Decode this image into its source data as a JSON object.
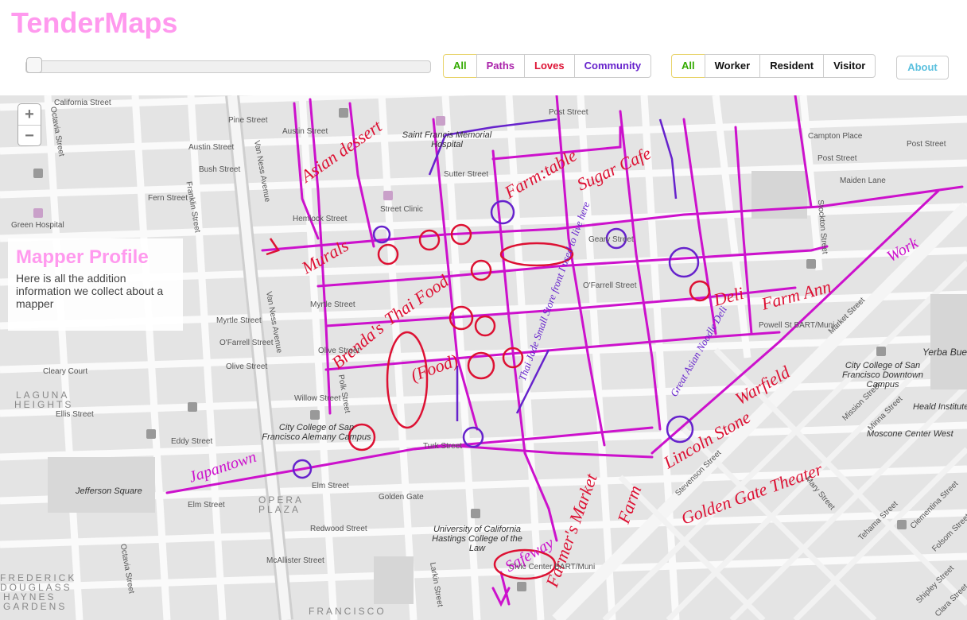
{
  "app": {
    "title": "TenderMaps"
  },
  "filters": {
    "type_buttons": [
      {
        "label": "All",
        "color": "#33aa00"
      },
      {
        "label": "Paths",
        "color": "#aa22aa"
      },
      {
        "label": "Loves",
        "color": "#dd1133"
      },
      {
        "label": "Community",
        "color": "#6622cc"
      }
    ],
    "role_buttons": [
      {
        "label": "All",
        "color": "#33aa00"
      },
      {
        "label": "Worker",
        "color": "#111111"
      },
      {
        "label": "Resident",
        "color": "#111111"
      },
      {
        "label": "Visitor",
        "color": "#111111"
      }
    ],
    "about_label": "About"
  },
  "zoom": {
    "in": "+",
    "out": "−"
  },
  "profile": {
    "title": "Mapper Profile",
    "text": "Here is all the addition information we collect about a mapper"
  },
  "map": {
    "streets": [
      "California Street",
      "Pine Street",
      "Austin Street",
      "Austin Street",
      "Bush Street",
      "Fern Street",
      "Hemlock Street",
      "Sutter Street",
      "Post Street",
      "Geary Street",
      "O'Farrell Street",
      "Myrtle Street",
      "Myrtle Street",
      "O'Farrell Street",
      "Olive Street",
      "Olive Street",
      "Willow Street",
      "Ellis Street",
      "Eddy Street",
      "Turk Street",
      "Elm Street",
      "Elm Street",
      "Golden Gate",
      "Redwood Street",
      "McAllister Street",
      "Campton Place",
      "Post Street",
      "Post Street",
      "Maiden Lane",
      "Market Street",
      "Mission Street",
      "Minna Street",
      "Mary Street",
      "Stevenson Street",
      "Tehama Street",
      "Clementina Street",
      "Folsom Street",
      "Shipley Street",
      "Clara Street",
      "Stockton Street",
      "Van Ness Avenue",
      "Van Ness Avenue",
      "Polk Street",
      "Larkin Street",
      "Franklin Street",
      "Octavia Street",
      "Octavia Street",
      "Cleary Court"
    ],
    "places": [
      "Saint Francis Memorial Hospital",
      "Green Hospital",
      "Jefferson Square",
      "City College of San Francisco Alemany Campus",
      "University of California Hastings College of the Law",
      "City College of San Francisco Downtown Campus",
      "Heald Institute",
      "Moscone Center West",
      "Yerba Buena",
      "Powell St BART/Muni",
      "Civic Center BART/Muni",
      "Street Clinic"
    ],
    "areas": [
      "LAGUNA",
      "HEIGHTS",
      "OPERA",
      "PLAZA",
      "FREDERICK",
      "DOUGLASS",
      "HAYNES",
      "GARDENS",
      "FRANCISCO"
    ],
    "annotations": [
      "Asian dessert",
      "Farm:table",
      "Sugar Cafe",
      "Murals",
      "Thai Food",
      "Brenda's",
      "(Food)",
      "Japantown",
      "Thai Jade Small Store front I used to live here",
      "Great Asian Noodle Deli",
      "Deli",
      "Farm Ann",
      "Warfield",
      "Farmer's Market",
      "Safeway",
      "Farm",
      "Golden Gate Theater",
      "Work",
      "Lincoln Stone",
      "Farmers Market"
    ],
    "colors": {
      "paths": "#cc11cc",
      "loves": "#dd1133",
      "community": "#6622cc",
      "water": "#f5f5f5",
      "block": "#f7f7f7",
      "road": "#ffffff"
    }
  }
}
